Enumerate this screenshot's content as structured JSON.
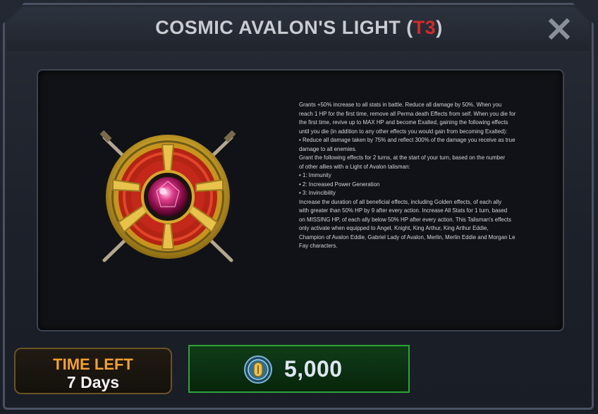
{
  "dialog": {
    "title_main": "COSMIC AVALON'S LIGHT (",
    "title_tier": "T3",
    "title_end": ")",
    "close_icon": "close-x-icon"
  },
  "item": {
    "emblem_icon": "avalon-light-talisman-icon",
    "description": [
      "Grants +50% increase to all stats in battle. Reduce all damage by 50%. When you",
      "reach 1 HP for the first time, remove all Perma death Effects from self. When you die for",
      "the first time, revive up to MAX HP and become Exalted, gaining the following effects",
      "until you die (in addition to any other effects you would gain from becoming Exalted):",
      "• Reduce all damage taken by 75% and reflect 300% of the damage you receive as true",
      "damage to all enemies.",
      " Grant the following effects for 2 turns, at the start of your turn, based on the number",
      "of other allies with a Light of Avalon talisman:",
      "• 1: Immunity",
      "• 2: Increased Power Generation",
      "• 3: Invincibility",
      " Increase the duration of all beneficial effects, including Golden effects, of each ally",
      "with greater than 50% HP by 9 after every action. Increase All Stats for 1 turn, based",
      "on MISSING HP, of each ally below 50% HP after every action. This Talisman's effects",
      "only activate when equipped to Angel, Knight, King Arthur, King Arthur Eddie,",
      "Champion of Avalon Eddie, Gabriel Lady of Avalon, Merlin, Merlin Eddie and Morgan Le",
      "Fay characters."
    ]
  },
  "time_left": {
    "label": "TIME LEFT",
    "value": "7 Days"
  },
  "purchase": {
    "currency_icon": "gold-coin-icon",
    "price": "5,000"
  },
  "colors": {
    "tier": "#d12a2a",
    "time_label": "#f2a22a",
    "button_border": "#2fa337"
  }
}
